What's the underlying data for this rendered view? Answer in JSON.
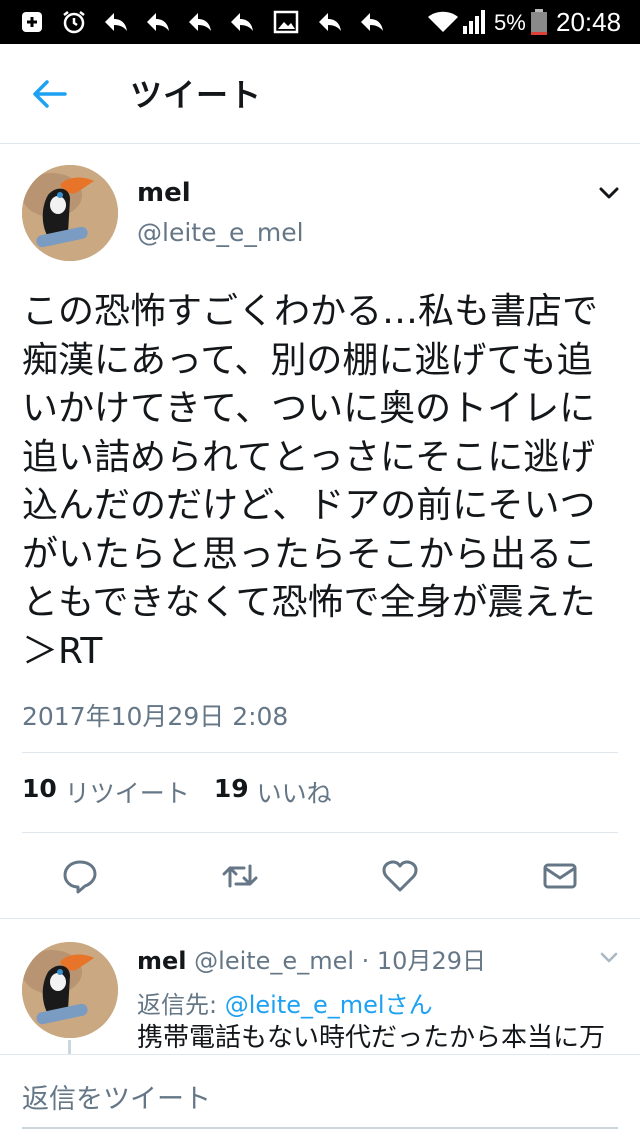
{
  "status_bar": {
    "battery_percent": "5%",
    "time": "20:48",
    "icons": [
      "plus-box-icon",
      "alarm-icon",
      "reply-arrow-icon",
      "reply-arrow-icon",
      "reply-arrow-icon",
      "reply-arrow-icon",
      "image-icon",
      "reply-arrow-icon",
      "reply-arrow-icon",
      "wifi-icon",
      "signal-icon",
      "battery-icon"
    ]
  },
  "header": {
    "back_icon": "back-arrow-icon",
    "title": "ツイート"
  },
  "tweet": {
    "author_name": "mel",
    "author_handle": "@leite_e_mel",
    "text": "この恐怖すごくわかる…私も書店で痴漢にあって、別の棚に逃げても追いかけてきて、ついに奥のトイレに追い詰められてとっさにそこに逃げ込んだのだけど、ドアの前にそいつがいたらと思ったらそこから出ることもできなくて恐怖で全身が震えた＞RT",
    "timestamp": "2017年10月29日 2:08",
    "retweet_count": "10",
    "retweet_label": "リツイート",
    "like_count": "19",
    "like_label": "いいね",
    "actions": [
      "reply-icon",
      "retweet-icon",
      "like-icon",
      "share-mail-icon"
    ]
  },
  "reply": {
    "author_name": "mel",
    "author_handle": "@leite_e_mel",
    "separator": " · ",
    "date": "10月29日",
    "reply_to_label": "返信先: ",
    "reply_to_handle": "@leite_e_melさん",
    "text": "携帯電話もない時代だったから本当に万"
  },
  "composer": {
    "placeholder": "返信をツイート"
  },
  "colors": {
    "accent": "#1da1f2",
    "secondary_text": "#657786",
    "primary_text": "#14171a",
    "divider": "#e1e8ed"
  }
}
